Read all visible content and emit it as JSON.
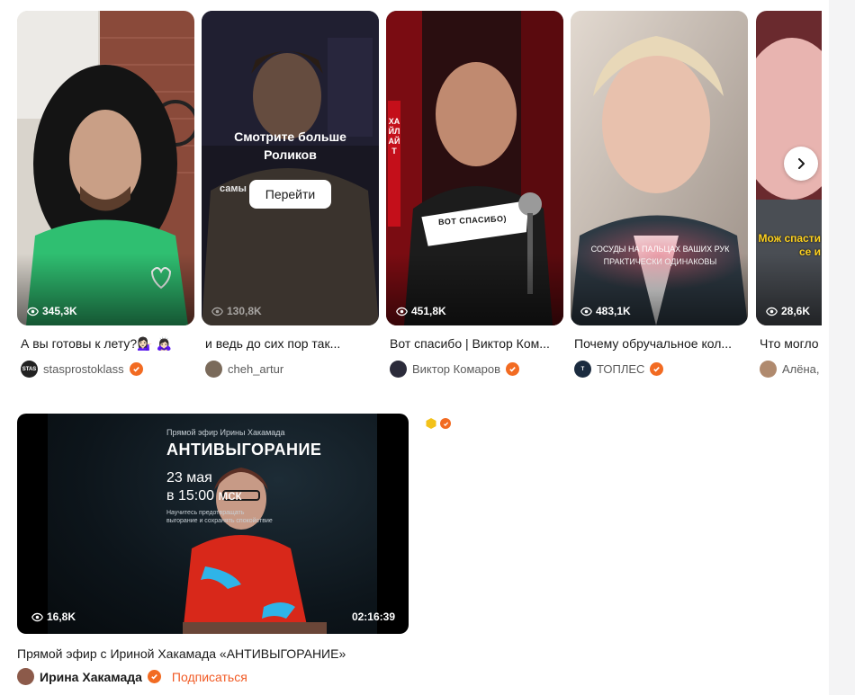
{
  "shelf": {
    "cards": [
      {
        "views": "345,3K",
        "title": "А вы готовы к лету?💁🏻‍♀️ 🙇🏻‍♀️",
        "author": "stasprostoklass",
        "verified": true
      },
      {
        "views": "130,8K",
        "title": "и ведь до сих пор так...",
        "author": "cheh_artur",
        "verified": false,
        "overlay": {
          "line1": "Смотрите больше",
          "line2": "Роликов",
          "button": "Перейти",
          "peek_text": "самы"
        }
      },
      {
        "views": "451,8K",
        "title": "Вот спасибо | Виктор Ком...",
        "author": "Виктор Комаров",
        "verified": true,
        "overlay_text": {
          "side": "ХАЙЛАЙТ",
          "sign": "ВОТ СПАСИБО)"
        }
      },
      {
        "views": "483,1K",
        "title": "Почему обручальное кол...",
        "author": "ТОПЛЕС",
        "verified": true,
        "caption": "СОСУДЫ НА ПАЛЬЦАХ ВАШИХ РУК ПРАКТИЧЕСКИ ОДИНАКОВЫ"
      },
      {
        "views": "28,6K",
        "title": "Что могло",
        "author": "Алёна,",
        "verified": false,
        "caption": "Мож спасти се и"
      }
    ],
    "next_icon": "chevron-right-icon"
  },
  "featured": {
    "views": "16,8K",
    "duration": "02:16:39",
    "title": "Прямой эфир с Ириной Хакамада «АНТИВЫГОРАНИЕ»",
    "author": "Ирина Хакамада",
    "verified": true,
    "subscribe": "Подписаться",
    "poster": {
      "kicker": "Прямой эфир Ирины Хакамада",
      "heading": "АНТИВЫГОРАНИЕ",
      "date": "23 мая",
      "time": "в 15:00 мск",
      "desc": "Научитесь предотвращать выгорание и сохранять спокойствие"
    }
  },
  "colors": {
    "accent": "#f26b22",
    "subscribe": "#f15a24"
  }
}
